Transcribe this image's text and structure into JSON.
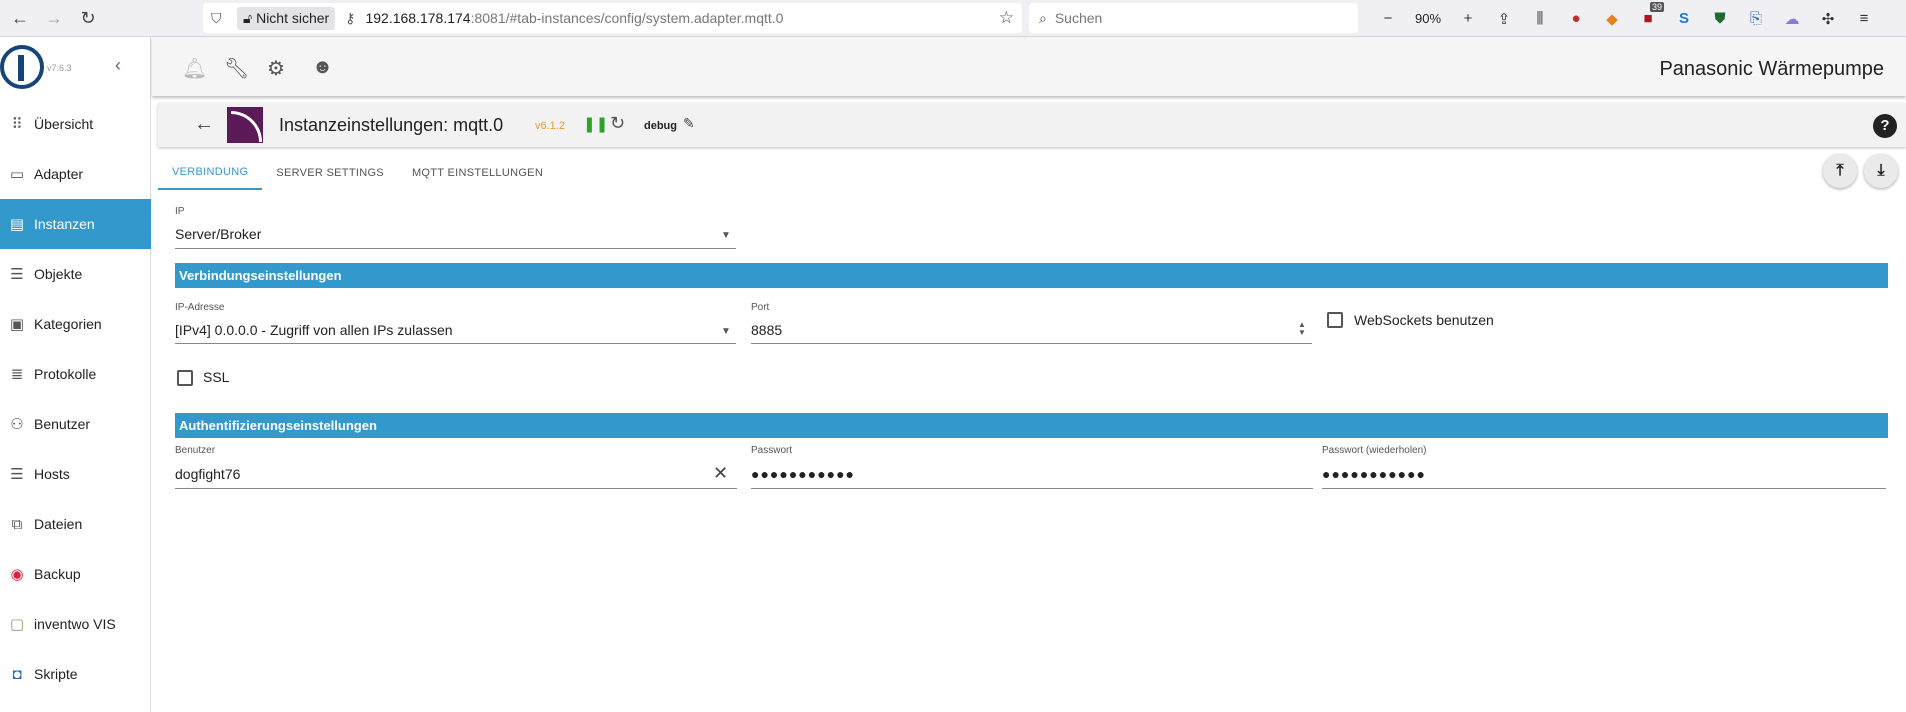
{
  "browser": {
    "security_label": "Nicht sicher",
    "url_host": "192.168.178.174",
    "url_rest": ":8081/#tab-instances/config/system.adapter.mqtt.0",
    "search_placeholder": "Suchen",
    "zoom": "90%",
    "badge_count": "39"
  },
  "sidebar": {
    "version": "v7.6.3",
    "items": [
      {
        "label": "Übersicht",
        "icon": "grid-icon"
      },
      {
        "label": "Adapter",
        "icon": "store-icon"
      },
      {
        "label": "Instanzen",
        "icon": "instances-icon"
      },
      {
        "label": "Objekte",
        "icon": "list-icon"
      },
      {
        "label": "Kategorien",
        "icon": "categories-icon"
      },
      {
        "label": "Protokolle",
        "icon": "log-icon"
      },
      {
        "label": "Benutzer",
        "icon": "user-icon"
      },
      {
        "label": "Hosts",
        "icon": "hosts-icon"
      },
      {
        "label": "Dateien",
        "icon": "files-icon"
      },
      {
        "label": "Backup",
        "icon": "backup-icon"
      },
      {
        "label": "inventwo VIS",
        "icon": "inventwo-icon"
      },
      {
        "label": "Skripte",
        "icon": "scripts-icon"
      }
    ]
  },
  "header": {
    "title": "Panasonic Wärmepumpe"
  },
  "instance": {
    "title": "Instanzeinstellungen: mqtt.0",
    "version": "v6.1.2",
    "log_level": "debug"
  },
  "tabs": [
    "VERBINDUNG",
    "SERVER SETTINGS",
    "MQTT EINSTELLUNGEN"
  ],
  "form": {
    "ip_label": "IP",
    "ip_value": "Server/Broker",
    "section_connection": "Verbindungseinstellungen",
    "ip_address_label": "IP-Adresse",
    "ip_address_value": "[IPv4] 0.0.0.0 - Zugriff von allen IPs zulassen",
    "port_label": "Port",
    "port_value": "8885",
    "websockets_label": "WebSockets benutzen",
    "ssl_label": "SSL",
    "section_auth": "Authentifizierungseinstellungen",
    "user_label": "Benutzer",
    "user_value": "dogfight76",
    "password_label": "Passwort",
    "password_value": "●●●●●●●●●●●",
    "password_repeat_label": "Passwort (wiederholen)",
    "password_repeat_value": "●●●●●●●●●●●"
  }
}
